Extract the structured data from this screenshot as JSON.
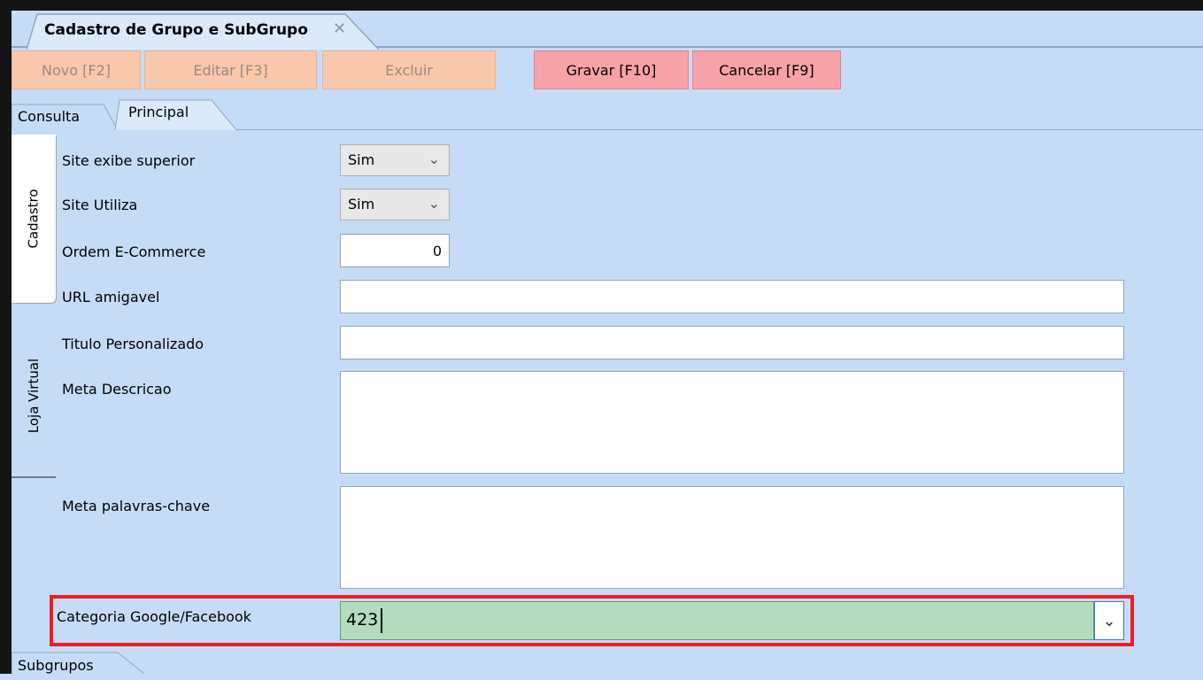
{
  "document_tab": {
    "title": "Cadastro de Grupo e SubGrupo",
    "close_symbol": "✕"
  },
  "toolbar": {
    "novo_label": "Novo [F2]",
    "editar_label": "Editar [F3]",
    "excluir_label": "Excluir",
    "gravar_label": "Gravar [F10]",
    "cancelar_label": "Cancelar [F9]"
  },
  "tabs": {
    "consulta": "Consulta",
    "principal": "Principal",
    "subgrupos": "Subgrupos"
  },
  "side_tabs": {
    "cadastro": "Cadastro",
    "loja_virtual": "Loja Virtual"
  },
  "form": {
    "site_exibe_superior": {
      "label": "Site exibe superior",
      "value": "Sim"
    },
    "site_utiliza": {
      "label": "Site Utiliza",
      "value": "Sim"
    },
    "ordem_ecommerce": {
      "label": "Ordem E-Commerce",
      "value": "0"
    },
    "url_amigavel": {
      "label": "URL amigavel",
      "value": ""
    },
    "titulo_personalizado": {
      "label": "Titulo Personalizado",
      "value": ""
    },
    "meta_descricao": {
      "label": "Meta Descricao",
      "value": ""
    },
    "meta_palavras_chave": {
      "label": "Meta palavras-chave",
      "value": ""
    },
    "categoria_google_facebook": {
      "label": "Categoria Google/Facebook",
      "value": "423"
    }
  },
  "colors": {
    "background": "#c6dcf6",
    "button_disabled": "#f9c7ac",
    "button_active": "#f7a2a8",
    "highlight_border": "#ee1c25",
    "focused_input": "#b4dbbd"
  },
  "icons": {
    "dropdown": "chevron-down-icon",
    "close": "close-icon"
  }
}
